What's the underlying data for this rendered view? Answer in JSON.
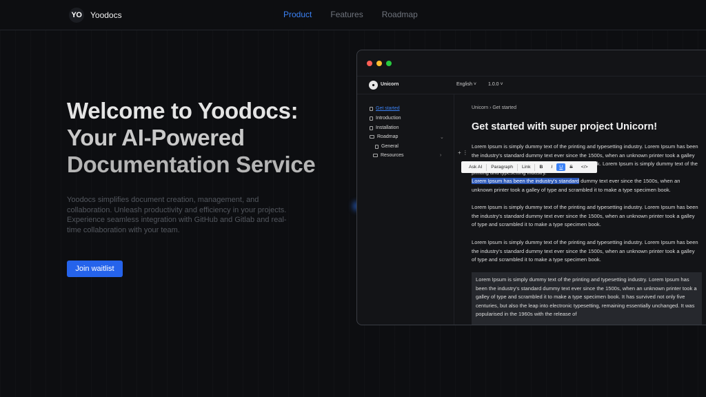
{
  "brand": {
    "logo_text": "YO",
    "name": "Yoodocs"
  },
  "nav": {
    "items": [
      "Product",
      "Features",
      "Roadmap"
    ],
    "active": "Product"
  },
  "hero": {
    "title_lines": [
      "Welcome to Yoodocs:",
      "Your AI-Powered",
      "Documentation Service"
    ],
    "description": "Yoodocs simplifies document creation, management, and collaboration. Unleash productivity and efficiency in your projects. Experience seamless integration with GitHub and Gitlab and real-time collaboration with your team.",
    "cta_label": "Join waitlist"
  },
  "app": {
    "name": "Unicorn",
    "language": "English ˅",
    "version": "1.0.0 ˅",
    "sidebar": [
      "Get started",
      "Introduction",
      "Installation",
      "Roadmap",
      "General",
      "Resources"
    ],
    "breadcrumb": "Unicorn  ›  Get started",
    "doc_title": "Get started with super project Unicorn!",
    "toolbar": [
      "Ask AI",
      "Paragraph",
      "Link",
      "B",
      "I",
      "U",
      "S",
      "</>"
    ],
    "para1": "Lorem Ipsum is simply dummy text of the printing and typesetting industry. Lorem Ipsum has been the industry's standard dummy text ever since the 1500s, when an unknown printer took a galley of type and scrambled it to make a type specimen book. Lorem Ipsum is simply dummy text of the printing and typesetting industry.",
    "para1_highlight": "Lorem Ipsum has been the industry's standard",
    "para1_rest": " dummy text ever since the 1500s, when an unknown printer took a galley of type and scrambled it to make a type specimen book.",
    "para2": "Lorem Ipsum is simply dummy text of the printing and typesetting industry. Lorem Ipsum has been the industry's standard dummy text ever since the 1500s, when an unknown printer took a galley of type and scrambled it to make a type specimen book.",
    "para3": "Lorem Ipsum is simply dummy text of the printing and typesetting industry. Lorem Ipsum has been the industry's standard dummy text ever since the 1500s, when an unknown printer took a galley of type and scrambled it to make a type specimen book.",
    "code": "Lorem Ipsum is simply dummy text of the printing and typesetting industry. Lorem Ipsum has been the industry's standard dummy text ever since the 1500s, when an unknown printer took a galley of type and scrambled it to make a type specimen book. It has survived not only five centuries, but also the leap into electronic typesetting, remaining essentially unchanged. It was popularised in the 1960s with the release of"
  },
  "colors": {
    "accent": "#3b82f6",
    "cta": "#2563eb",
    "background": "#0d0e11"
  }
}
